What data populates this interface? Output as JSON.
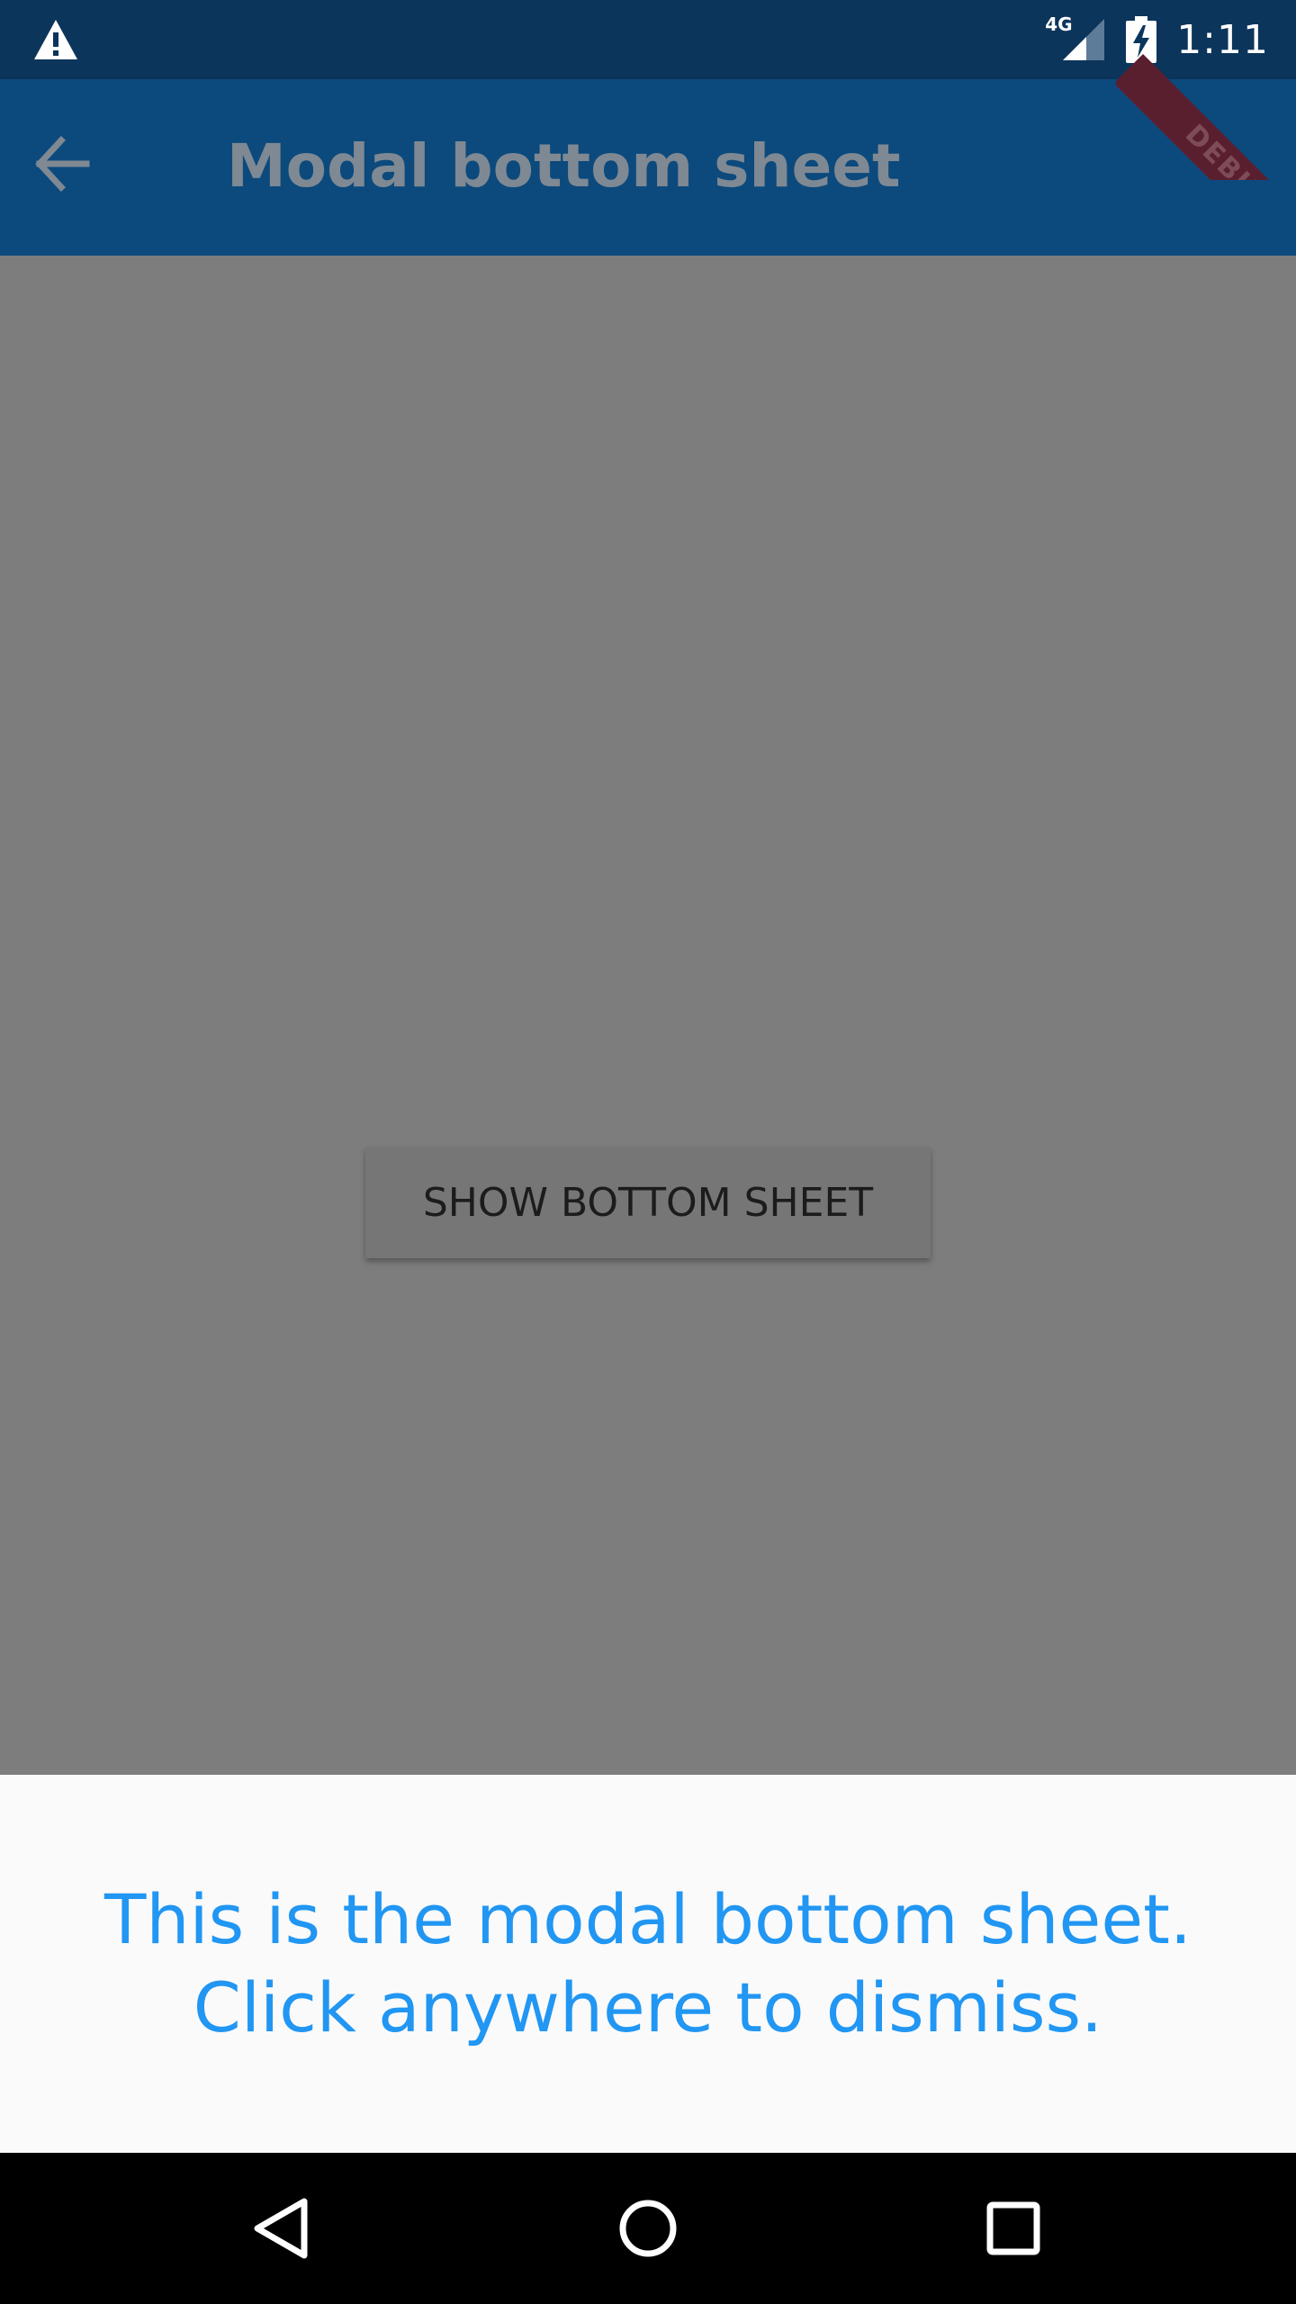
{
  "status_bar": {
    "time": "1:11",
    "network_label": "4G",
    "icons": [
      "warning-icon",
      "signal-icon",
      "battery-charging-icon"
    ]
  },
  "app_bar": {
    "title": "Modal bottom sheet",
    "back_icon": "arrow-back-icon"
  },
  "debug_banner": {
    "label": "DEBUG"
  },
  "main": {
    "show_button_label": "SHOW BOTTOM SHEET"
  },
  "bottom_sheet": {
    "line1": "This is the modal bottom sheet.",
    "line2": "Click anywhere to dismiss."
  },
  "nav_bar": {
    "icons": [
      "nav-back-icon",
      "nav-home-icon",
      "nav-recents-icon"
    ]
  },
  "colors": {
    "status_bar": "#0c355b",
    "app_bar": "#0c4a7d",
    "scrim": "#7d7d7d",
    "sheet_text": "#2196f3",
    "sheet_bg": "#fafafa"
  }
}
